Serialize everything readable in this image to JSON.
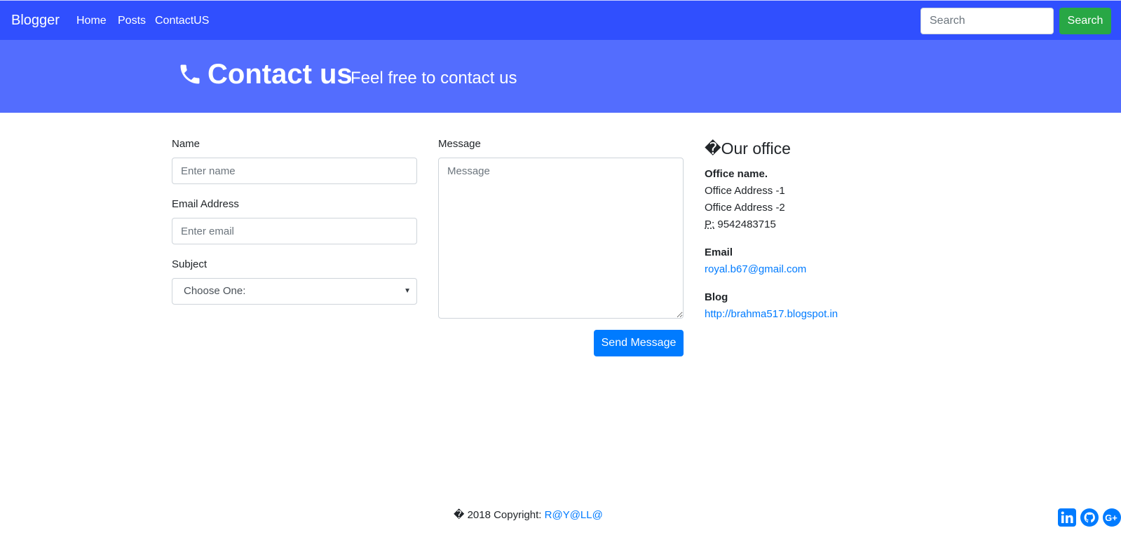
{
  "navbar": {
    "brand": "Blogger",
    "links": [
      "Home",
      "Posts",
      "ContactUS"
    ],
    "search_placeholder": "Search",
    "search_button": "Search"
  },
  "header": {
    "icon": "phone-icon",
    "title": "Contact us",
    "subtitle": "Feel free to contact us"
  },
  "form": {
    "name_label": "Name",
    "name_placeholder": "Enter name",
    "email_label": "Email Address",
    "email_placeholder": "Enter email",
    "subject_label": "Subject",
    "subject_selected": "Choose One:",
    "message_label": "Message",
    "message_placeholder": "Message",
    "send_button": "Send Message"
  },
  "office": {
    "title_glyph": "�",
    "title": "Our office",
    "name": "Office name.",
    "address1": "Office Address -1",
    "address2": "Office Address -2",
    "phone_label": "P:",
    "phone": "9542483715",
    "email_heading": "Email",
    "email": "royal.b67@gmail.com",
    "blog_heading": "Blog",
    "blog_url": "http://brahma517.blogspot.in"
  },
  "footer": {
    "copyright_glyph": "�",
    "copyright": "2018 Copyright:",
    "author": "R@Y@LL@",
    "social_icons": [
      "linkedin-icon",
      "github-icon",
      "google-plus-icon"
    ]
  },
  "colors": {
    "navbar": "#304ffe",
    "header": "#536dfe",
    "search_button": "#28a745",
    "primary": "#007bff"
  }
}
